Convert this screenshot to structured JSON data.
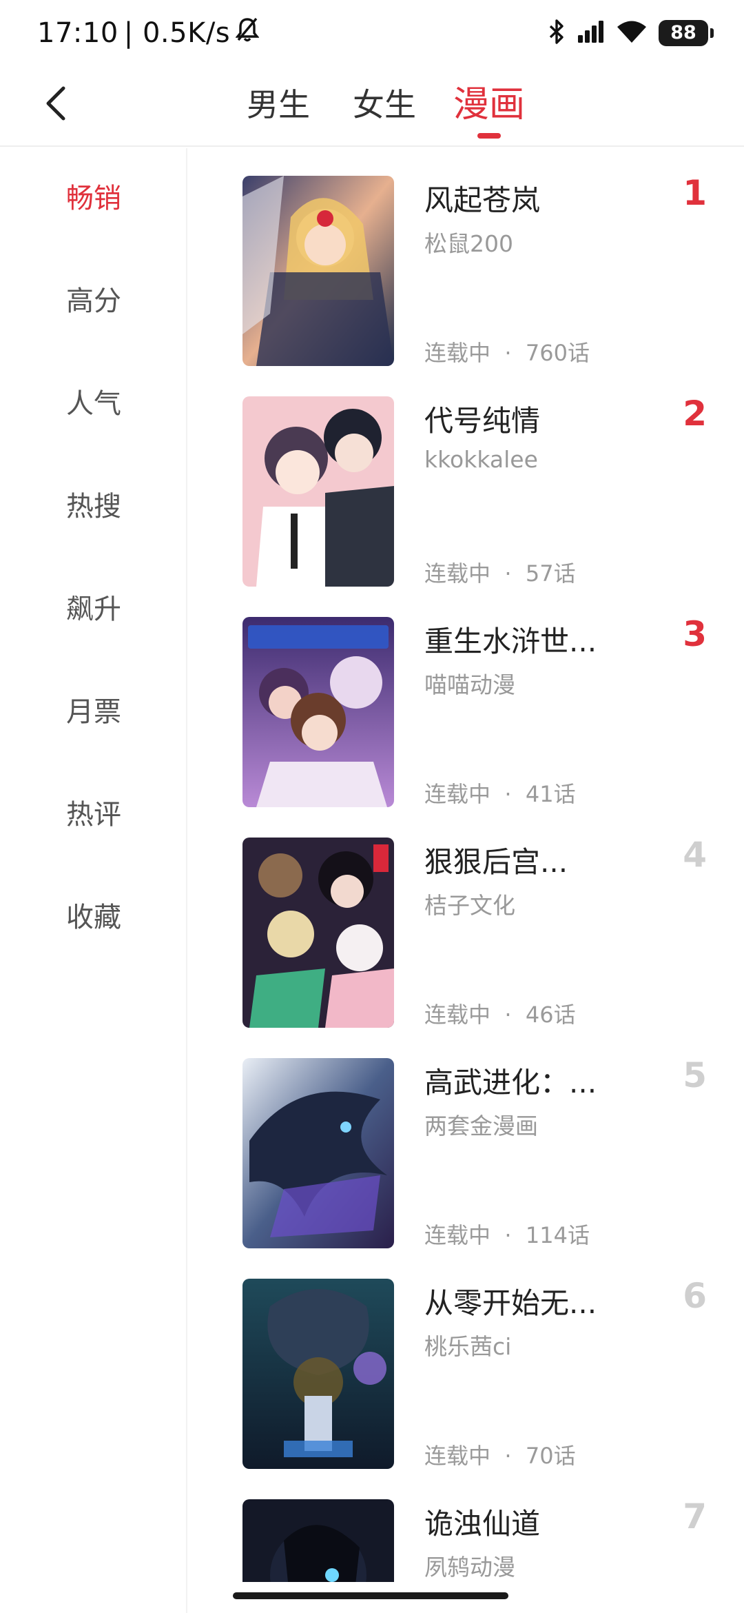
{
  "status": {
    "time": "17:10",
    "net": "| 0.5K/s",
    "battery": "88"
  },
  "nav": {
    "tabs": [
      {
        "label": "男生"
      },
      {
        "label": "女生"
      },
      {
        "label": "漫画"
      }
    ],
    "active_tab": "漫画"
  },
  "sidebar": {
    "items": [
      {
        "label": "畅销"
      },
      {
        "label": "高分"
      },
      {
        "label": "人气"
      },
      {
        "label": "热搜"
      },
      {
        "label": "飙升"
      },
      {
        "label": "月票"
      },
      {
        "label": "热评"
      },
      {
        "label": "收藏"
      }
    ],
    "active": "畅销"
  },
  "books": [
    {
      "rank": "1",
      "title": "风起苍岚",
      "author": "松鼠200",
      "status": "连载中",
      "sep": "·",
      "chapters": "760话"
    },
    {
      "rank": "2",
      "title": "代号纯情",
      "author": "kkokkalee",
      "status": "连载中",
      "sep": "·",
      "chapters": "57话"
    },
    {
      "rank": "3",
      "title": "重生水浒世...",
      "author": "喵喵动漫",
      "status": "连载中",
      "sep": "·",
      "chapters": "41话"
    },
    {
      "rank": "4",
      "title": "狠狠后宫...",
      "author": "桔子文化",
      "status": "连载中",
      "sep": "·",
      "chapters": "46话"
    },
    {
      "rank": "5",
      "title": "高武进化：...",
      "author": "两套金漫画",
      "status": "连载中",
      "sep": "·",
      "chapters": "114话"
    },
    {
      "rank": "6",
      "title": "从零开始无...",
      "author": "桃乐茜ci",
      "status": "连载中",
      "sep": "·",
      "chapters": "70话"
    },
    {
      "rank": "7",
      "title": "诡浊仙道",
      "author": "夙鸫动漫",
      "status": "",
      "sep": "",
      "chapters": ""
    }
  ],
  "colors": {
    "accent": "#e0313c",
    "muted_rank": "#cfcfcf"
  }
}
